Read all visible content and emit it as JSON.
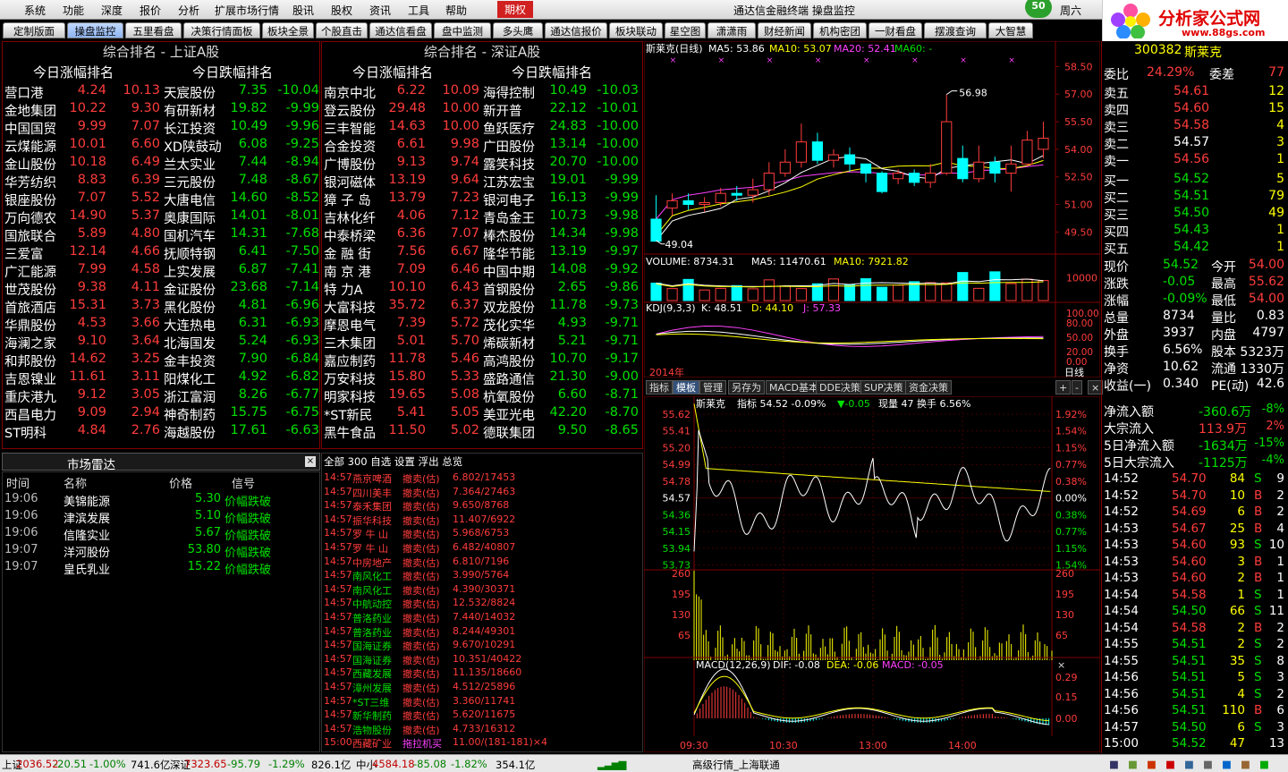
{
  "menu": {
    "items": [
      "系统",
      "功能",
      "深度",
      "报价",
      "分析",
      "扩展市场行情",
      "股讯",
      "股权",
      "资讯",
      "工具",
      "帮助"
    ],
    "futures": "期权",
    "title": "通达信金融终端   操盘监控",
    "badge": "50",
    "weekday": "周六"
  },
  "logo": {
    "name": "分析家公式网",
    "url": "www.88gs.com"
  },
  "tabs": [
    "定制版面",
    "操盘监控",
    "五里看盘",
    "决策行情面板",
    "板块全景",
    "个股直击",
    "通达信看盘",
    "盘中监测",
    "多头鹰",
    "通达信报价",
    "板块联动",
    "星空图",
    "潇潇雨",
    "财经新闻",
    "机构密团",
    "一财看盘",
    "摆渡查询",
    "大智慧"
  ],
  "sh": {
    "title": "综合排名 - 上证A股",
    "up_head": "今日涨幅排名",
    "down_head": "今日跌幅排名",
    "up": [
      [
        "营口港",
        "4.24",
        "10.13"
      ],
      [
        "金地集团",
        "10.22",
        "9.30"
      ],
      [
        "中国国贸",
        "9.99",
        "7.07"
      ],
      [
        "云煤能源",
        "10.01",
        "6.60"
      ],
      [
        "金山股份",
        "10.18",
        "6.49"
      ],
      [
        "华芳纺织",
        "8.83",
        "6.39"
      ],
      [
        "银座股份",
        "7.07",
        "5.52"
      ],
      [
        "万向德农",
        "14.90",
        "5.37"
      ],
      [
        "国旅联合",
        "5.89",
        "4.80"
      ],
      [
        "三爱富",
        "12.14",
        "4.66"
      ],
      [
        "广汇能源",
        "7.99",
        "4.58"
      ],
      [
        "世茂股份",
        "9.38",
        "4.11"
      ],
      [
        "首旅酒店",
        "15.31",
        "3.73"
      ],
      [
        "华鼎股份",
        "4.53",
        "3.66"
      ],
      [
        "海澜之家",
        "9.10",
        "3.64"
      ],
      [
        "和邦股份",
        "14.62",
        "3.25"
      ],
      [
        "吉恩镍业",
        "11.61",
        "3.11"
      ],
      [
        "重庆港九",
        "9.12",
        "3.05"
      ],
      [
        "西昌电力",
        "9.09",
        "2.94"
      ],
      [
        "ST明科",
        "4.84",
        "2.76"
      ]
    ],
    "down": [
      [
        "天宸股份",
        "7.35",
        "-10.04"
      ],
      [
        "有研新材",
        "19.82",
        "-9.99"
      ],
      [
        "长江投资",
        "10.49",
        "-9.96"
      ],
      [
        "XD陕鼓动",
        "6.08",
        "-9.25"
      ],
      [
        "兰太实业",
        "7.44",
        "-8.94"
      ],
      [
        "三元股份",
        "7.48",
        "-8.67"
      ],
      [
        "大唐电信",
        "14.60",
        "-8.52"
      ],
      [
        "奥康国际",
        "14.01",
        "-8.01"
      ],
      [
        "国机汽车",
        "14.31",
        "-7.68"
      ],
      [
        "抚顺特钢",
        "6.41",
        "-7.50"
      ],
      [
        "上实发展",
        "6.87",
        "-7.41"
      ],
      [
        "金证股份",
        "23.68",
        "-7.14"
      ],
      [
        "黑化股份",
        "4.81",
        "-6.96"
      ],
      [
        "大连热电",
        "6.31",
        "-6.93"
      ],
      [
        "北海国发",
        "5.24",
        "-6.93"
      ],
      [
        "金丰投资",
        "7.90",
        "-6.84"
      ],
      [
        "阳煤化工",
        "4.92",
        "-6.82"
      ],
      [
        "浙江富润",
        "8.26",
        "-6.77"
      ],
      [
        "神奇制药",
        "15.75",
        "-6.75"
      ],
      [
        "海越股份",
        "17.61",
        "-6.63"
      ]
    ]
  },
  "sz": {
    "title": "综合排名 - 深证A股",
    "up_head": "今日涨幅排名",
    "down_head": "今日跌幅排名",
    "up": [
      [
        "南京中北",
        "6.22",
        "10.09"
      ],
      [
        "登云股份",
        "29.48",
        "10.00"
      ],
      [
        "三丰智能",
        "14.63",
        "10.00"
      ],
      [
        "合金投资",
        "6.61",
        "9.98"
      ],
      [
        "广博股份",
        "9.13",
        "9.74"
      ],
      [
        "银河磁体",
        "13.19",
        "9.64"
      ],
      [
        "獐 子 岛",
        "13.79",
        "7.23"
      ],
      [
        "吉林化纤",
        "4.06",
        "7.12"
      ],
      [
        "中泰桥梁",
        "6.36",
        "7.07"
      ],
      [
        "金 融 街",
        "7.56",
        "6.67"
      ],
      [
        "南 京 港",
        "7.09",
        "6.46"
      ],
      [
        "特  力A",
        "10.10",
        "6.43"
      ],
      [
        "大富科技",
        "35.72",
        "6.37"
      ],
      [
        "摩恩电气",
        "7.39",
        "5.72"
      ],
      [
        "三木集团",
        "5.01",
        "5.70"
      ],
      [
        "嘉应制药",
        "11.78",
        "5.46"
      ],
      [
        "万安科技",
        "15.80",
        "5.33"
      ],
      [
        "明家科技",
        "19.65",
        "5.08"
      ],
      [
        "*ST新民",
        "5.41",
        "5.05"
      ],
      [
        "黑牛食品",
        "11.50",
        "5.02"
      ]
    ],
    "down": [
      [
        "海得控制",
        "10.49",
        "-10.03"
      ],
      [
        "新开普",
        "22.12",
        "-10.01"
      ],
      [
        "鱼跃医疗",
        "24.83",
        "-10.00"
      ],
      [
        "广田股份",
        "13.14",
        "-10.00"
      ],
      [
        "露笑科技",
        "20.70",
        "-10.00"
      ],
      [
        "江苏宏宝",
        "19.01",
        "-9.99"
      ],
      [
        "银河电子",
        "16.13",
        "-9.99"
      ],
      [
        "青岛金王",
        "10.73",
        "-9.98"
      ],
      [
        "棒杰股份",
        "14.34",
        "-9.98"
      ],
      [
        "隆华节能",
        "13.19",
        "-9.97"
      ],
      [
        "中国中期",
        "14.08",
        "-9.92"
      ],
      [
        "首钢股份",
        "2.65",
        "-9.86"
      ],
      [
        "双龙股份",
        "11.78",
        "-9.73"
      ],
      [
        "茂化实华",
        "4.93",
        "-9.71"
      ],
      [
        "烯碳新材",
        "5.21",
        "-9.71"
      ],
      [
        "高鸿股份",
        "10.70",
        "-9.17"
      ],
      [
        "盛路通信",
        "21.30",
        "-9.00"
      ],
      [
        "杭氧股份",
        "6.60",
        "-8.71"
      ],
      [
        "美亚光电",
        "42.20",
        "-8.70"
      ],
      [
        "德联集团",
        "9.50",
        "-8.65"
      ]
    ]
  },
  "radar": {
    "title": "市场雷达",
    "cols": [
      "时间",
      "名称",
      "价格",
      "信号"
    ],
    "rows": [
      [
        "19:06",
        "美锦能源",
        "5.30",
        "价幅跌破"
      ],
      [
        "19:06",
        "津滨发展",
        "5.10",
        "价幅跌破"
      ],
      [
        "19:06",
        "信隆实业",
        "5.67",
        "价幅跌破"
      ],
      [
        "19:07",
        "洋河股份",
        "53.80",
        "价幅跌破"
      ],
      [
        "19:07",
        "皇氏乳业",
        "15.22",
        "价幅跌破"
      ]
    ]
  },
  "ticker": {
    "head": "全部  300  自选      设置  浮出  总览",
    "rows": [
      [
        "14:57",
        "燕京啤酒",
        "撤卖(估)",
        "6.802/17453"
      ],
      [
        "14:57",
        "四川美丰",
        "撤卖(估)",
        "7.364/27463"
      ],
      [
        "14:57",
        "泰禾集团",
        "撤卖(估)",
        "9.650/8768"
      ],
      [
        "14:57",
        "振华科技",
        "撤卖(估)",
        "11.407/6922"
      ],
      [
        "14:57",
        "罗 牛 山",
        "撤卖(估)",
        "5.968/6753"
      ],
      [
        "14:57",
        "罗 牛 山",
        "撤卖(估)",
        "6.482/40807"
      ],
      [
        "14:57",
        "中房地产",
        "撤卖(估)",
        "6.810/7196"
      ],
      [
        "14:57",
        "南风化工",
        "撤卖(估)",
        "3.990/5764"
      ],
      [
        "14:57",
        "南风化工",
        "撤卖(估)",
        "4.390/30371"
      ],
      [
        "14:57",
        "中航动控",
        "撤卖(估)",
        "12.532/8824"
      ],
      [
        "14:57",
        "普洛药业",
        "撤卖(估)",
        "7.440/14032"
      ],
      [
        "14:57",
        "普洛药业",
        "撤卖(估)",
        "8.244/49301"
      ],
      [
        "14:57",
        "国海证券",
        "撤卖(估)",
        "9.670/10291"
      ],
      [
        "14:57",
        "国海证券",
        "撤卖(估)",
        "10.351/40422"
      ],
      [
        "14:57",
        "西藏发展",
        "撤卖(估)",
        "11.135/18660"
      ],
      [
        "14:57",
        "漳州发展",
        "撤卖(估)",
        "4.512/25896"
      ],
      [
        "14:57",
        "*ST三维",
        "撤卖(估)",
        "3.360/11741"
      ],
      [
        "14:57",
        "新华制药",
        "撤卖(估)",
        "5.620/11675"
      ],
      [
        "14:57",
        "浩物股份",
        "撤卖(估)",
        "4.733/16312"
      ],
      [
        "15:00",
        "西藏矿业",
        "拖拉机买",
        "11.00/(181-181)×4"
      ]
    ]
  },
  "kline": {
    "title": "斯莱克(日线)",
    "ma5": "MA5: 53.86",
    "ma10": "MA10: 53.07",
    "ma20": "MA20: 52.41",
    "ma60": "MA60: -",
    "yticks": [
      "58.50",
      "57.00",
      "55.50",
      "54.00",
      "52.50",
      "51.00",
      "49.50"
    ],
    "high": "56.98",
    "low": "49.04",
    "vol": "VOLUME: 8734.31",
    "vma5": "MA5: 11470.61",
    "vma10": "MA10: 7921.82",
    "vtick": "10000",
    "kdj": "KDJ(9,3,3)",
    "k": "K: 48.51",
    "d": "D: 44.10",
    "j": "J: 57.33",
    "kticks": [
      "100.00",
      "80.00",
      "50.00",
      "20.00",
      "0.00"
    ],
    "year": "2014年",
    "day": "日线",
    "candles": [
      [
        50.2,
        49.0,
        51.5,
        49.0
      ],
      [
        50.8,
        51.2,
        51.6,
        50.4
      ],
      [
        51.2,
        51.0,
        51.6,
        50.7
      ],
      [
        51.0,
        51.1,
        51.4,
        50.6
      ],
      [
        51.1,
        51.6,
        51.9,
        50.9
      ],
      [
        51.6,
        51.5,
        52.0,
        51.2
      ],
      [
        51.5,
        51.8,
        52.4,
        51.1
      ],
      [
        51.8,
        52.7,
        53.3,
        51.5
      ],
      [
        52.7,
        53.3,
        54.0,
        52.5
      ],
      [
        53.3,
        54.4,
        55.4,
        53.0
      ],
      [
        54.4,
        53.4,
        54.9,
        53.2
      ],
      [
        53.4,
        53.7,
        54.0,
        53.0
      ],
      [
        53.7,
        53.2,
        54.1,
        52.8
      ],
      [
        53.2,
        52.7,
        53.2,
        52.2
      ],
      [
        52.7,
        51.7,
        52.8,
        51.6
      ],
      [
        52.4,
        52.7,
        52.9,
        52.1
      ],
      [
        52.7,
        52.2,
        52.9,
        52.0
      ],
      [
        52.2,
        52.7,
        53.2,
        51.9
      ],
      [
        52.7,
        55.5,
        56.98,
        52.6
      ],
      [
        53.5,
        52.4,
        54.2,
        52.2
      ],
      [
        52.4,
        53.3,
        54.2,
        52.2
      ],
      [
        53.3,
        52.7,
        53.6,
        52.2
      ],
      [
        52.7,
        53.2,
        54.2,
        51.7
      ],
      [
        53.2,
        54.5,
        55.0,
        53.1
      ],
      [
        54.0,
        54.6,
        55.5,
        53.5
      ]
    ],
    "volumes": [
      7600,
      5200,
      9200,
      4600,
      5300,
      6500,
      5100,
      9000,
      6200,
      5200,
      7300,
      9400,
      6800,
      9500,
      5800,
      6700,
      8200,
      7800,
      7700,
      12200,
      5300,
      12500,
      7400,
      9300,
      8700
    ]
  },
  "itabs": [
    "指标",
    "模板",
    "管理",
    "另存为",
    "MACD基本",
    "DDE决策",
    "SUP决策",
    "资金决策"
  ],
  "intraday": {
    "name": "斯莱克",
    "ind": "指标 54.52 -0.09%",
    "chg": "▼-0.05",
    "now": "现量 47 换手 6.56%",
    "ypl": [
      "55.62",
      "55.41",
      "55.20",
      "54.99",
      "54.78",
      "54.57",
      "54.36",
      "54.15",
      "53.94",
      "53.73"
    ],
    "ypr": [
      "1.92%",
      "1.54%",
      "1.15%",
      "0.77%",
      "0.38%",
      "0.00%",
      "0.38%",
      "0.77%",
      "1.15%",
      "1.54%"
    ],
    "vt": [
      "260",
      "195",
      "130",
      "65"
    ],
    "macd": "MACD(12,26,9)",
    "dif": "DIF: -0.08",
    "dea": "DEA: -0.06",
    "mval": "MACD: -0.05",
    "mt": [
      "0.29",
      "0.15",
      "0.00"
    ],
    "times": [
      "09:30",
      "10:30",
      "13:00",
      "14:00"
    ]
  },
  "quote": {
    "code": "300382",
    "name": "斯莱克",
    "webi": [
      "委比",
      "24.29%",
      "委差",
      "77"
    ],
    "sells": [
      [
        "卖五",
        "54.61",
        "12"
      ],
      [
        "卖四",
        "54.60",
        "15"
      ],
      [
        "卖三",
        "54.58",
        "4"
      ],
      [
        "卖二",
        "54.57",
        "3"
      ],
      [
        "卖一",
        "54.56",
        "1"
      ]
    ],
    "buys": [
      [
        "买一",
        "54.52",
        "5"
      ],
      [
        "买二",
        "54.51",
        "79"
      ],
      [
        "买三",
        "54.50",
        "49"
      ],
      [
        "买四",
        "54.43",
        "1"
      ],
      [
        "买五",
        "54.42",
        "1"
      ]
    ],
    "stats": [
      [
        "现价",
        "54.52",
        "今开",
        "54.00"
      ],
      [
        "涨跌",
        "-0.05",
        "最高",
        "55.62"
      ],
      [
        "涨幅",
        "-0.09%",
        "最低",
        "54.00"
      ],
      [
        "总量",
        "8734",
        "量比",
        "0.83"
      ],
      [
        "外盘",
        "3937",
        "内盘",
        "4797"
      ],
      [
        "换手",
        "6.56%",
        "股本",
        "5323万"
      ],
      [
        "净资",
        "10.62",
        "流通",
        "1330万"
      ],
      [
        "收益(一)",
        "0.340",
        "PE(动)",
        "42.6"
      ]
    ],
    "flows": [
      [
        "净流入额",
        "-360.6万",
        "-8%"
      ],
      [
        "大宗流入",
        "113.9万",
        "2%"
      ],
      [
        "5日净流入额",
        "-1634万",
        "-15%"
      ],
      [
        "5日大宗流入",
        "-1125万",
        "-4%"
      ]
    ],
    "ticks": [
      [
        "14:52",
        "54.70",
        "84",
        "S",
        "9"
      ],
      [
        "14:52",
        "54.70",
        "10",
        "B",
        "2"
      ],
      [
        "14:52",
        "54.69",
        "6",
        "B",
        "2"
      ],
      [
        "14:53",
        "54.67",
        "25",
        "B",
        "4"
      ],
      [
        "14:53",
        "54.60",
        "93",
        "S",
        "10"
      ],
      [
        "14:53",
        "54.60",
        "3",
        "B",
        "1"
      ],
      [
        "14:53",
        "54.60",
        "2",
        "B",
        "1"
      ],
      [
        "14:54",
        "54.58",
        "1",
        "S",
        "1"
      ],
      [
        "14:54",
        "54.50",
        "66",
        "S",
        "11"
      ],
      [
        "14:54",
        "54.58",
        "2",
        "B",
        "2"
      ],
      [
        "14:55",
        "54.51",
        "2",
        "S",
        "2"
      ],
      [
        "14:55",
        "54.51",
        "35",
        "S",
        "8"
      ],
      [
        "14:56",
        "54.51",
        "5",
        "S",
        "3"
      ],
      [
        "14:56",
        "54.51",
        "4",
        "S",
        "2"
      ],
      [
        "14:56",
        "54.51",
        "110",
        "B",
        "6"
      ],
      [
        "14:57",
        "54.50",
        "6",
        "S",
        "3"
      ],
      [
        "15:00",
        "54.52",
        "47",
        "",
        "13"
      ]
    ]
  },
  "status": {
    "sh": "上证",
    "sh_v": "2036.52",
    "sh_c": "-20.51",
    "sh_p": "-1.00%",
    "sh_a": "741.6亿",
    "sz": "深证",
    "sz_v": "7323.65",
    "sz_c": "-95.79",
    "sz_p": "-1.29%",
    "sz_a": "826.1亿",
    "zx": "中小",
    "zx_v": "4584.18",
    "zx_c": "-85.08",
    "zx_p": "-1.82%",
    "zx_a": "354.1亿",
    "feed": "高级行情_上海联通"
  }
}
